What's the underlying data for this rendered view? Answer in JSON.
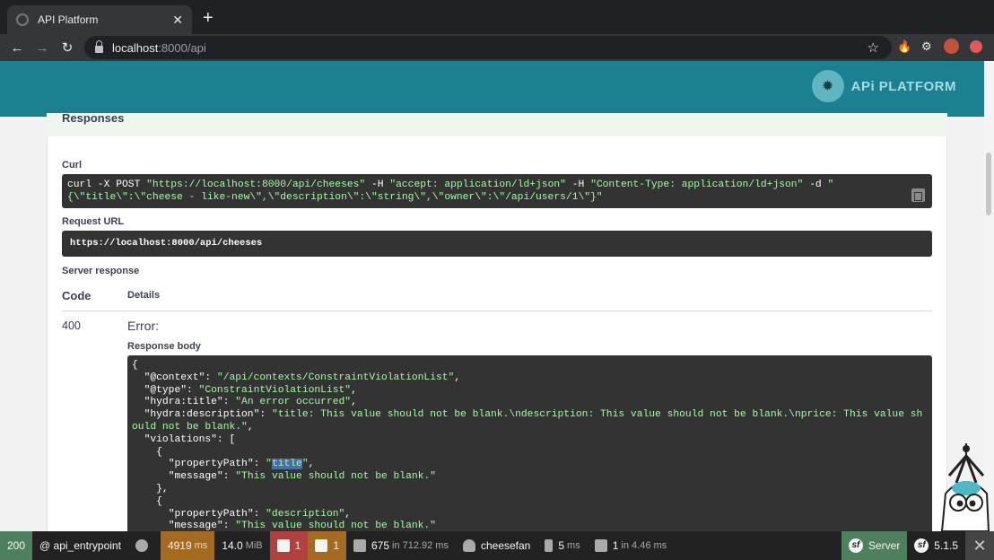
{
  "browser": {
    "tab_title": "API Platform",
    "tab_close": "✕",
    "new_tab": "+",
    "url_host": "localhost",
    "url_path": ":8000/api"
  },
  "header": {
    "logo_text": "APi PLATFORM"
  },
  "responses": {
    "section_title": "Responses",
    "curl_label": "Curl",
    "curl_command_parts": {
      "a": "curl -X POST ",
      "b": "\"https://localhost:8000/api/cheeses\"",
      "c": " -H  ",
      "d": "\"accept: application/ld+json\"",
      "e": " -H  ",
      "f": "\"Content-Type: application/ld+json\"",
      "g": " -d ",
      "h": "\"{\\\"title\\\":\\\"cheese - like-new\\\",\\\"description\\\":\\\"string\\\",\\\"owner\\\":\\\"/api/users/1\\\"}\""
    },
    "request_url_label": "Request URL",
    "request_url": "https://localhost:8000/api/cheeses",
    "server_response_label": "Server response",
    "col_code": "Code",
    "col_details": "Details",
    "status_code": "400",
    "error_title": "Error:",
    "response_body_label": "Response body",
    "body": {
      "l1": "{",
      "l2_key": "  \"@context\": ",
      "l2_val": "\"/api/contexts/ConstraintViolationList\"",
      "l3_key": "  \"@type\": ",
      "l3_val": "\"ConstraintViolationList\"",
      "l4_key": "  \"hydra:title\": ",
      "l4_val": "\"An error occurred\"",
      "l5_key": "  \"hydra:description\": ",
      "l5_val": "\"title: This value should not be blank.\\ndescription: This value should not be blank.\\nprice: This value should not be blank.\"",
      "l6": "  \"violations\": [",
      "l7": "    {",
      "l8_key": "      \"propertyPath\": ",
      "l8_q1": "\"",
      "l8_hl": "title",
      "l8_q2": "\"",
      "l9_key": "      \"message\": ",
      "l9_val": "\"This value should not be blank.\"",
      "l10": "    },",
      "l11": "    {",
      "l12_key": "      \"propertyPath\": ",
      "l12_val": "\"description\"",
      "l13_key": "      \"message\": ",
      "l13_val": "\"This value should not be blank.\""
    }
  },
  "symfony_toolbar": {
    "status": "200",
    "route": "@ api_entrypoint",
    "time": "4919",
    "time_unit": "ms",
    "memory": "14.0",
    "memory_unit": "MiB",
    "requests_count": "1",
    "errors_count": "1",
    "cache": "675",
    "cache_suffix": "in 712.92",
    "cache_unit": "ms",
    "user": "cheesefan",
    "twig_time": "5",
    "twig_unit": "ms",
    "db_queries": "1",
    "db_suffix": "in 4.46",
    "db_unit": "ms",
    "server_label": "Server",
    "version": "5.1.5"
  },
  "colors": {
    "header_teal": "#1b8191",
    "code_bg": "#333333",
    "string_green": "#a2fca2",
    "status_ok": "#4f805d"
  }
}
